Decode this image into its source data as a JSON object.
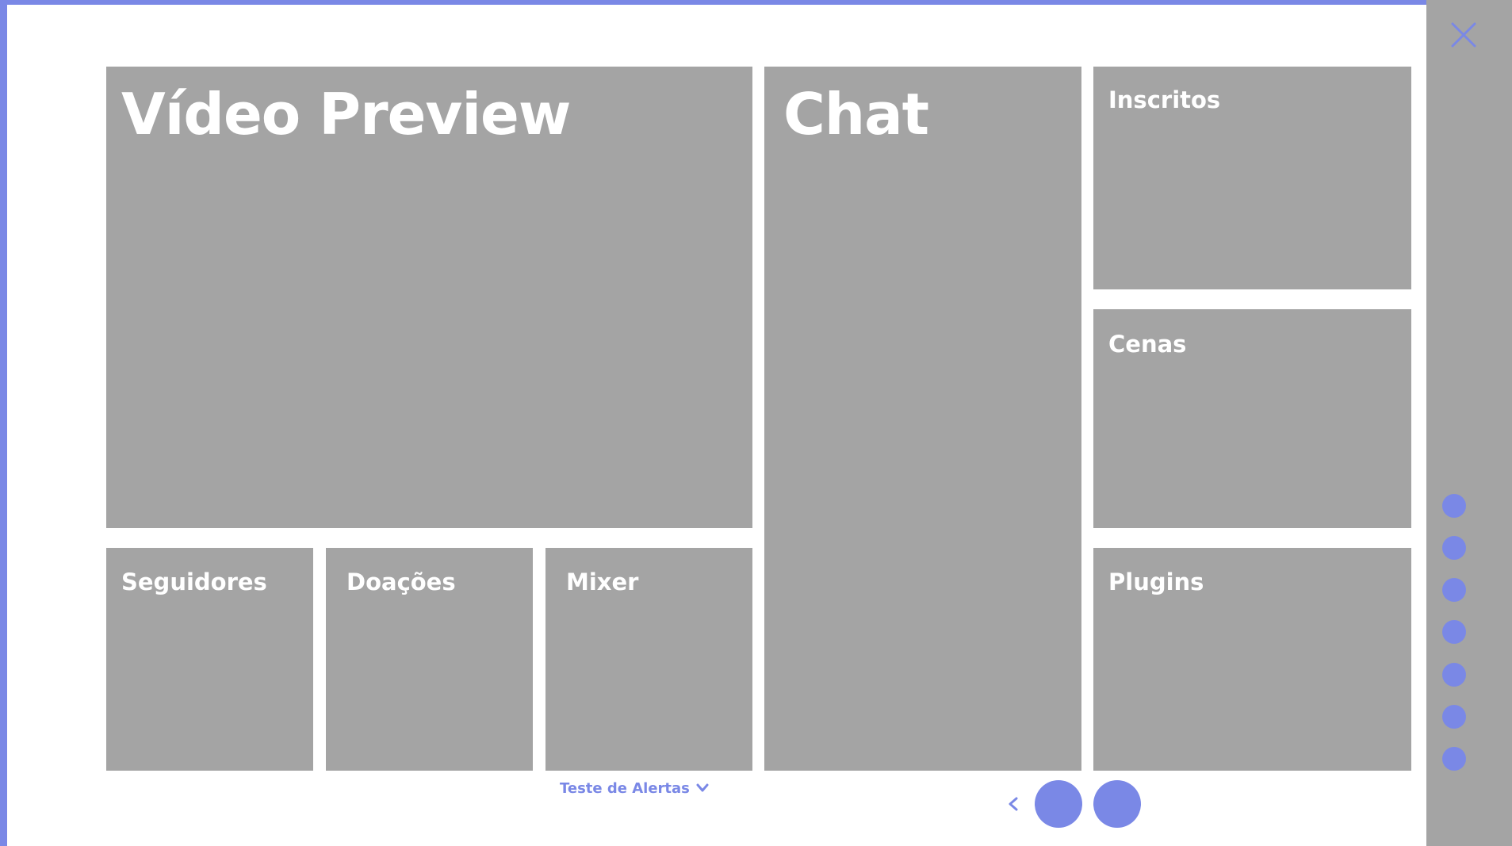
{
  "colors": {
    "accent": "#7a88e6",
    "panel": "#a4a4a4",
    "panel_text": "#ffffff",
    "background": "#ffffff"
  },
  "panels": {
    "video_preview": "Vídeo Preview",
    "chat": "Chat",
    "inscritos": "Inscritos",
    "cenas": "Cenas",
    "seguidores": "Seguidores",
    "doacoes": "Doações",
    "mixer": "Mixer",
    "plugins": "Plugins"
  },
  "footer": {
    "alerts_label": "Teste de Alertas",
    "alerts_icon": "chevron-down-icon",
    "prev_icon": "chevron-left-icon"
  },
  "sidebar": {
    "close_icon": "close-icon",
    "dot_count": 7
  }
}
